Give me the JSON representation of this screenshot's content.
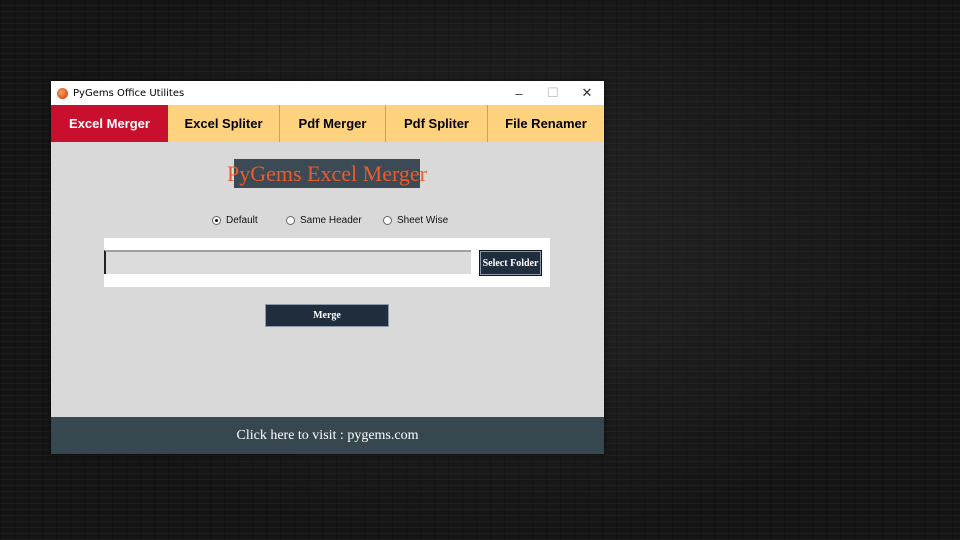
{
  "window": {
    "title": "PyGems Office Utilites",
    "controls": {
      "minimize": "–",
      "maximize": "☐",
      "close": "✕"
    }
  },
  "tabs": [
    {
      "label": "Excel Merger",
      "active": true
    },
    {
      "label": "Excel Spliter",
      "active": false
    },
    {
      "label": "Pdf Merger",
      "active": false
    },
    {
      "label": "Pdf Spliter",
      "active": false
    },
    {
      "label": "File Renamer",
      "active": false
    }
  ],
  "main": {
    "heading": "PyGems Excel Merger",
    "radio_options": [
      {
        "label": "Default",
        "checked": true
      },
      {
        "label": "Same Header",
        "checked": false
      },
      {
        "label": "Sheet Wise",
        "checked": false
      }
    ],
    "folder_input": {
      "value": "",
      "placeholder": ""
    },
    "select_folder_label": "Select Folder",
    "merge_label": "Merge"
  },
  "footer": {
    "link_text": "Click here to visit : pygems.com"
  },
  "colors": {
    "active_tab": "#c8102e",
    "tab_bar": "#ffd27f",
    "heading_bg": "#3b4a55",
    "heading_text": "#f05a28",
    "button_bg": "#1f2d3d",
    "footer_bg": "#37474f",
    "content_bg": "#d9d9d9"
  },
  "icons": {
    "app": "pygems-gem-icon"
  }
}
